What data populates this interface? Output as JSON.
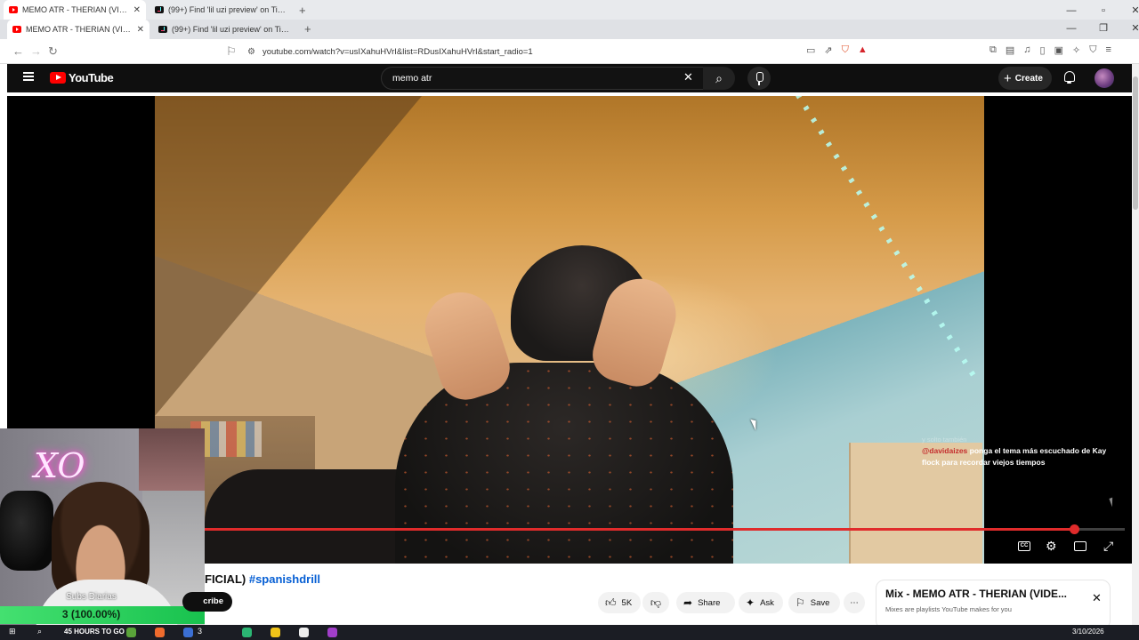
{
  "browser": {
    "tabs_row1": [
      {
        "title": "MEMO ATR - THERIAN (VIDE",
        "icon": "youtube-favicon"
      },
      {
        "title": "(99+) Find 'lil uzi preview' on TikTok |",
        "icon": "tiktok-favicon"
      }
    ],
    "tabs_row2": [
      {
        "title": "MEMO ATR - THERIAN (VIDE",
        "icon": "youtube-favicon"
      },
      {
        "title": "(99+) Find 'lil uzi preview' on TikTok |",
        "icon": "tiktok-favicon"
      }
    ],
    "new_tab": "+",
    "close": "✕",
    "url": "youtube.com/watch?v=usIXahuHVrI&list=RDusIXahuHVrI&start_radio=1"
  },
  "youtube": {
    "logo_text": "YouTube",
    "search_value": "memo atr",
    "create_label": "Create",
    "clear": "✕",
    "search_glyph": "⌕"
  },
  "player": {
    "progress": 0.955,
    "chat_faint": "y solto también",
    "chat_user": "@davidaizes",
    "chat_message": "ponga el tema más escuchado de Kay flock para recordar viejos tiempos",
    "cc_label": "CC",
    "gear_glyph": "⚙",
    "fullscreen_glyph": "⤢"
  },
  "webcam": {
    "neon_text": "XO",
    "subs_label": "Subs Diarias",
    "subs_value": "3 (100.00%)"
  },
  "video_info": {
    "title_visible": "FICIAL)",
    "hashtag": "#spanishdrill",
    "subscribe_partial": "cribe",
    "like_count": "5K",
    "share_label": "Share",
    "ask_label": "Ask",
    "save_label": "Save",
    "more": "⋯"
  },
  "mix": {
    "title": "Mix - MEMO ATR - THERIAN (VIDE...",
    "subtitle": "Mixes are playlists YouTube makes for you",
    "close": "✕"
  },
  "taskbar": {
    "label": "45 HOURS TO GO",
    "badge": "3",
    "date": "3/10/2026"
  },
  "colors": {
    "yt_red": "#ff0000",
    "progress_red": "#e02b2b",
    "link_blue": "#065fd4",
    "subs_green": "#22c75a"
  }
}
